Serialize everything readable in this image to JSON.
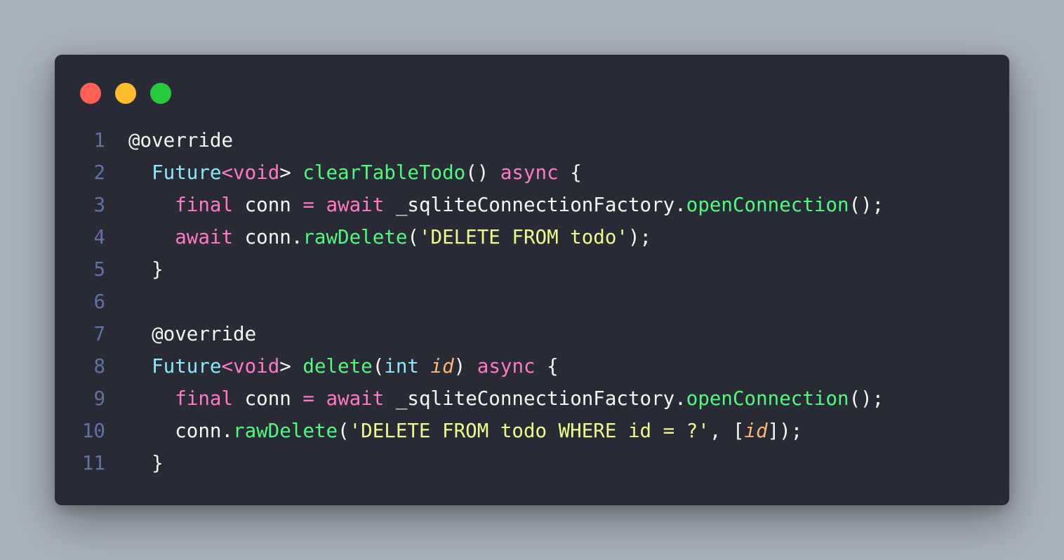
{
  "colors": {
    "background": "#a7b1bc",
    "window": "#282a36",
    "close": "#ff5f56",
    "minimize": "#ffbd2e",
    "maximize": "#27c93f"
  },
  "traffic_lights": [
    {
      "name": "close-button",
      "color": "#ff5f56"
    },
    {
      "name": "minimize-button",
      "color": "#ffbd2e"
    },
    {
      "name": "maximize-button",
      "color": "#27c93f"
    }
  ],
  "code_lines": [
    {
      "number": "1",
      "tokens": [
        {
          "text": "@override",
          "color": "#f8f8f2"
        }
      ]
    },
    {
      "number": "2",
      "tokens": [
        {
          "text": "  ",
          "color": "#f8f8f2"
        },
        {
          "text": "Future",
          "color": "#8be9fd"
        },
        {
          "text": "<",
          "color": "#ff79c6"
        },
        {
          "text": "void",
          "color": "#ff79c6"
        },
        {
          "text": "> ",
          "color": "#f8f8f2"
        },
        {
          "text": "clearTableTodo",
          "color": "#50fa7b"
        },
        {
          "text": "() ",
          "color": "#f8f8f2"
        },
        {
          "text": "async",
          "color": "#ff79c6"
        },
        {
          "text": " {",
          "color": "#f8f8f2"
        }
      ]
    },
    {
      "number": "3",
      "tokens": [
        {
          "text": "    ",
          "color": "#f8f8f2"
        },
        {
          "text": "final",
          "color": "#ff79c6"
        },
        {
          "text": " conn ",
          "color": "#f8f8f2"
        },
        {
          "text": "=",
          "color": "#ff79c6"
        },
        {
          "text": " ",
          "color": "#f8f8f2"
        },
        {
          "text": "await",
          "color": "#ff79c6"
        },
        {
          "text": " _sqliteConnectionFactory.",
          "color": "#f8f8f2"
        },
        {
          "text": "openConnection",
          "color": "#50fa7b"
        },
        {
          "text": "();",
          "color": "#f8f8f2"
        }
      ]
    },
    {
      "number": "4",
      "tokens": [
        {
          "text": "    ",
          "color": "#f8f8f2"
        },
        {
          "text": "await",
          "color": "#ff79c6"
        },
        {
          "text": " conn.",
          "color": "#f8f8f2"
        },
        {
          "text": "rawDelete",
          "color": "#50fa7b"
        },
        {
          "text": "(",
          "color": "#f8f8f2"
        },
        {
          "text": "'DELETE FROM todo'",
          "color": "#f1fa8c"
        },
        {
          "text": ");",
          "color": "#f8f8f2"
        }
      ]
    },
    {
      "number": "5",
      "tokens": [
        {
          "text": "  }",
          "color": "#f8f8f2"
        }
      ]
    },
    {
      "number": "6",
      "tokens": []
    },
    {
      "number": "7",
      "tokens": [
        {
          "text": "  @override",
          "color": "#f8f8f2"
        }
      ]
    },
    {
      "number": "8",
      "tokens": [
        {
          "text": "  ",
          "color": "#f8f8f2"
        },
        {
          "text": "Future",
          "color": "#8be9fd"
        },
        {
          "text": "<",
          "color": "#ff79c6"
        },
        {
          "text": "void",
          "color": "#ff79c6"
        },
        {
          "text": "> ",
          "color": "#f8f8f2"
        },
        {
          "text": "delete",
          "color": "#50fa7b"
        },
        {
          "text": "(",
          "color": "#f8f8f2"
        },
        {
          "text": "int",
          "color": "#8be9fd"
        },
        {
          "text": " ",
          "color": "#f8f8f2"
        },
        {
          "text": "id",
          "color": "#ffb86c",
          "italic": true
        },
        {
          "text": ") ",
          "color": "#f8f8f2"
        },
        {
          "text": "async",
          "color": "#ff79c6"
        },
        {
          "text": " {",
          "color": "#f8f8f2"
        }
      ]
    },
    {
      "number": "9",
      "tokens": [
        {
          "text": "    ",
          "color": "#f8f8f2"
        },
        {
          "text": "final",
          "color": "#ff79c6"
        },
        {
          "text": " conn ",
          "color": "#f8f8f2"
        },
        {
          "text": "=",
          "color": "#ff79c6"
        },
        {
          "text": " ",
          "color": "#f8f8f2"
        },
        {
          "text": "await",
          "color": "#ff79c6"
        },
        {
          "text": " _sqliteConnectionFactory.",
          "color": "#f8f8f2"
        },
        {
          "text": "openConnection",
          "color": "#50fa7b"
        },
        {
          "text": "();",
          "color": "#f8f8f2"
        }
      ]
    },
    {
      "number": "10",
      "tokens": [
        {
          "text": "    conn.",
          "color": "#f8f8f2"
        },
        {
          "text": "rawDelete",
          "color": "#50fa7b"
        },
        {
          "text": "(",
          "color": "#f8f8f2"
        },
        {
          "text": "'DELETE FROM todo WHERE id = ?'",
          "color": "#f1fa8c"
        },
        {
          "text": ", [",
          "color": "#f8f8f2"
        },
        {
          "text": "id",
          "color": "#ffb86c",
          "italic": true
        },
        {
          "text": "]);",
          "color": "#f8f8f2"
        }
      ]
    },
    {
      "number": "11",
      "tokens": [
        {
          "text": "  }",
          "color": "#f8f8f2"
        }
      ]
    }
  ]
}
